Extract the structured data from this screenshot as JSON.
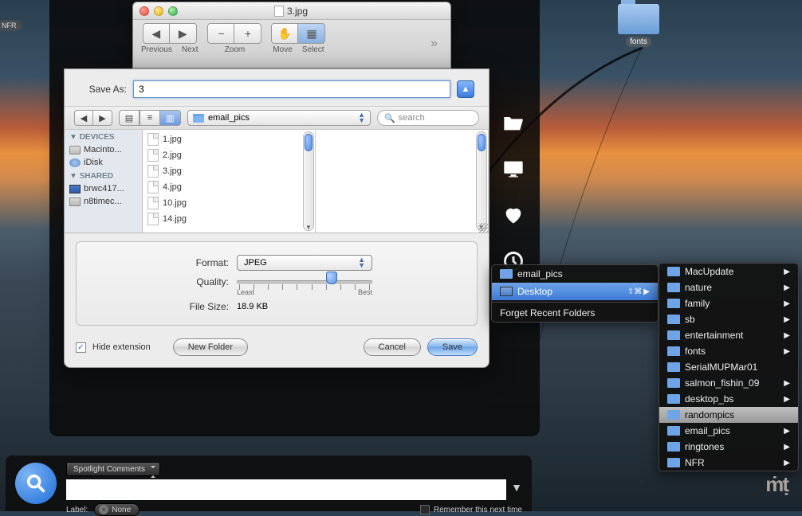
{
  "desktop": {
    "folderLabel": "fonts",
    "nfrBadge": "NFR"
  },
  "previewWindow": {
    "title": "3.jpg",
    "toolbar": {
      "previous": "Previous",
      "next": "Next",
      "zoom": "Zoom",
      "move": "Move",
      "select": "Select"
    }
  },
  "saveSheet": {
    "saveAsLabel": "Save As:",
    "saveAsValue": "3",
    "pathDropdown": "email_pics",
    "searchPlaceholder": "search",
    "sidebar": {
      "devicesHeader": "DEVICES",
      "devices": [
        {
          "label": "Macinto...",
          "icon": "hd"
        },
        {
          "label": "iDisk",
          "icon": "idisk"
        }
      ],
      "sharedHeader": "SHARED",
      "shared": [
        {
          "label": "brwc417...",
          "icon": "pc"
        },
        {
          "label": "n8timec...",
          "icon": "share"
        }
      ]
    },
    "files": [
      "1.jpg",
      "2.jpg",
      "3.jpg",
      "4.jpg",
      "10.jpg",
      "14.jpg"
    ],
    "formatLabel": "Format:",
    "formatValue": "JPEG",
    "qualityLabel": "Quality:",
    "qualityLeast": "Least",
    "qualityBest": "Best",
    "fileSizeLabel": "File Size:",
    "fileSizeValue": "18.9 KB",
    "hideExtension": "Hide extension",
    "newFolder": "New Folder",
    "cancel": "Cancel",
    "save": "Save"
  },
  "recentPopup": {
    "items": [
      {
        "label": "email_pics",
        "type": "folder"
      },
      {
        "label": "Desktop",
        "type": "desktop",
        "shortcut": "⇧⌘",
        "arrow": true
      }
    ],
    "forget": "Forget Recent Folders"
  },
  "folderSubmenu": [
    {
      "label": "MacUpdate",
      "arrow": true
    },
    {
      "label": "nature",
      "arrow": true
    },
    {
      "label": "family",
      "arrow": true
    },
    {
      "label": "sb",
      "arrow": true
    },
    {
      "label": "entertainment",
      "arrow": true
    },
    {
      "label": "fonts",
      "arrow": true
    },
    {
      "label": "SerialMUPMar01"
    },
    {
      "label": "salmon_fishin_09",
      "arrow": true
    },
    {
      "label": "desktop_bs",
      "arrow": true
    },
    {
      "label": "randompics",
      "selected": true
    },
    {
      "label": "email_pics",
      "arrow": true
    },
    {
      "label": "ringtones",
      "arrow": true
    },
    {
      "label": "NFR",
      "arrow": true
    }
  ],
  "bottomPanel": {
    "dropdown": "Spotlight Comments",
    "label": "Label:",
    "none": "None",
    "remember": "Remember this next time"
  }
}
